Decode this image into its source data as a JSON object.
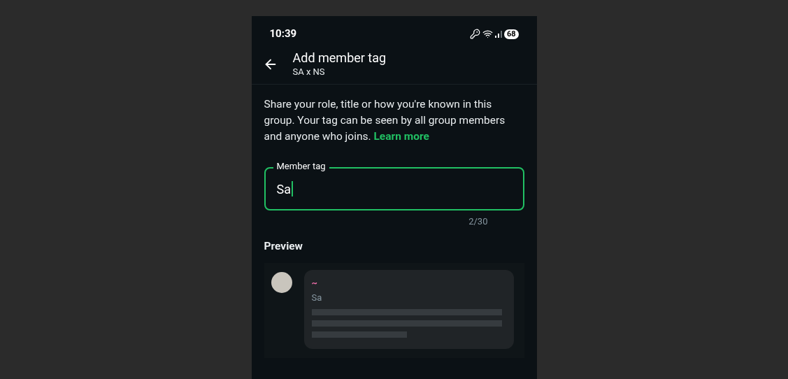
{
  "status_bar": {
    "time": "10:39",
    "battery": "68"
  },
  "header": {
    "title": "Add member tag",
    "subtitle": "SA x NS"
  },
  "description": {
    "text": "Share your role, title or how you're known in this group. Your tag can be seen by all group members and anyone who joins.",
    "link": "Learn more"
  },
  "field": {
    "label": "Member tag",
    "value": "Sa",
    "focused": true,
    "counter": "2/30"
  },
  "preview": {
    "heading": "Preview",
    "sender": "~",
    "tag": "Sa"
  }
}
